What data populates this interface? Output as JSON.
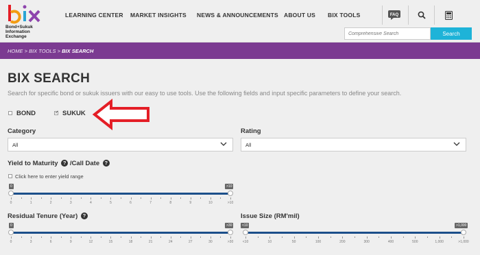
{
  "brand": {
    "logo_text": "bix",
    "logo_line1": "Bond+Sukuk",
    "logo_line2": "Information",
    "logo_line3": "Exchange"
  },
  "nav": {
    "items": [
      "LEARNING CENTER",
      "MARKET INSIGHTS",
      "NEWS & ANNOUNCEMENTS",
      "ABOUT US",
      "BIX TOOLS"
    ],
    "faq": "FAQ"
  },
  "search": {
    "placeholder": "Comprehensive Search",
    "button": "Search"
  },
  "breadcrumb": {
    "home": "HOME",
    "tools": "BIX TOOLS",
    "current": "BIX SEARCH",
    "sep": ">"
  },
  "page": {
    "title": "BIX SEARCH",
    "description": "Search for specific bond or sukuk issuers with our easy to use tools. Use the following fields and input specific parameters to define your search."
  },
  "filters": {
    "bond": {
      "label": "BOND",
      "checked": false
    },
    "sukuk": {
      "label": "SUKUK",
      "checked": true
    },
    "category": {
      "label": "Category",
      "value": "All"
    },
    "rating": {
      "label": "Rating",
      "value": "All"
    },
    "ytm": {
      "label": "Yield to Maturity",
      "label2": "/Call Date",
      "range_checkbox": "Click here to enter yield range",
      "min_badge": "0",
      "max_badge": ">10",
      "ticks": [
        "0",
        "1",
        "2",
        "3",
        "4",
        "5",
        "6",
        "7",
        "8",
        "9",
        "10",
        ">10"
      ]
    },
    "tenure": {
      "label": "Residual Tenure (Year)",
      "min_badge": "0",
      "max_badge": ">30",
      "ticks": [
        "0",
        "3",
        "6",
        "9",
        "12",
        "15",
        "18",
        "21",
        "24",
        "27",
        "30",
        ">30"
      ]
    },
    "issue_size": {
      "label": "Issue Size (RM'mil)",
      "min_badge": "<10",
      "max_badge": ">1,000",
      "ticks": [
        "<10",
        "10",
        "50",
        "100",
        "200",
        "300",
        "400",
        "500",
        "1,000",
        ">1,000"
      ]
    }
  },
  "colors": {
    "brand_purple": "#7b3a91",
    "accent_cyan": "#1eb3d8",
    "track_blue": "#1c4f8a",
    "arrow_red": "#e41e26"
  }
}
